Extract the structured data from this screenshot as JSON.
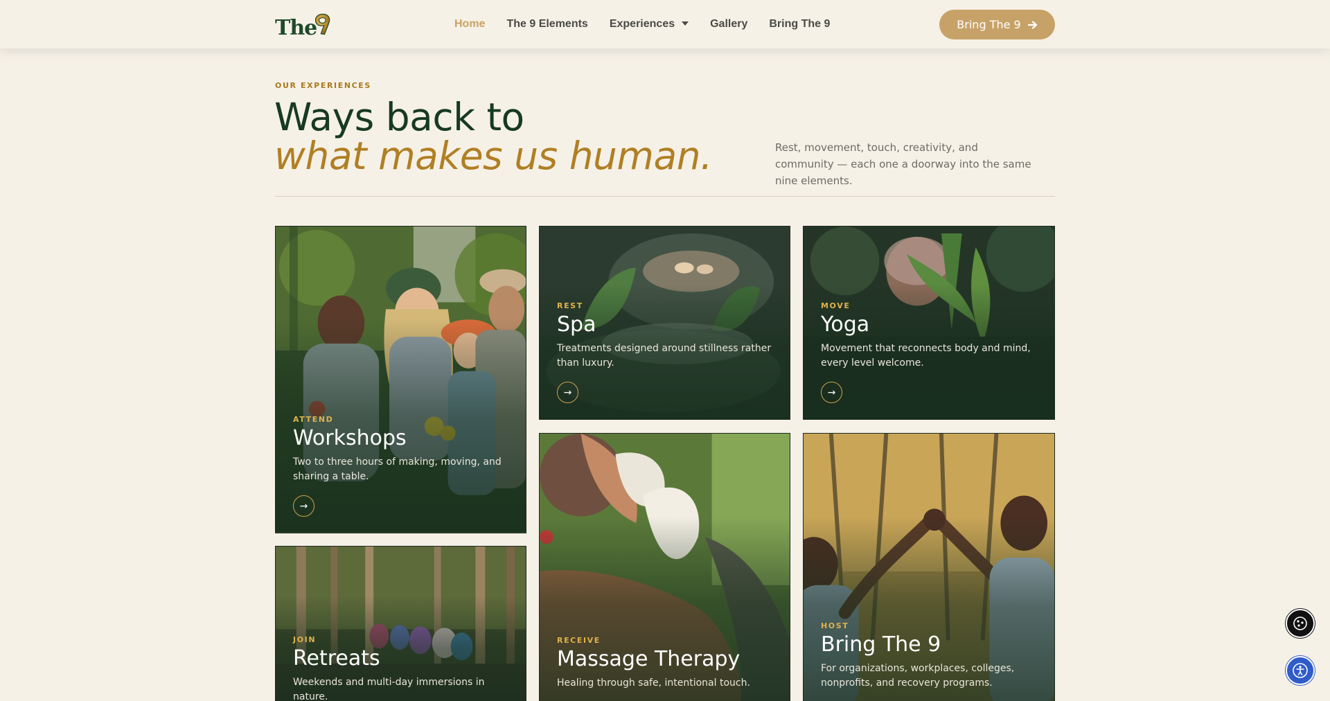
{
  "header": {
    "logo_text": "The",
    "nav": [
      {
        "label": "Home",
        "active": true
      },
      {
        "label": "The 9 Elements"
      },
      {
        "label": "Experiences",
        "dropdown": true
      },
      {
        "label": "Gallery"
      },
      {
        "label": "Bring The 9"
      }
    ],
    "cta_label": "Bring The 9",
    "cta_icon": "arrow-right-icon"
  },
  "intro": {
    "eyebrow": "OUR EXPERIENCES",
    "headline_line1": "Ways back to",
    "headline_line2": "what makes us human.",
    "text": "Rest, movement, touch, creativity, and community — each one a doorway into the same nine elements."
  },
  "cards": {
    "workshops": {
      "tag": "ATTEND",
      "title": "Workshops",
      "desc": "Two to three hours of making, moving, and sharing a table.",
      "arrow": "→"
    },
    "spa": {
      "tag": "REST",
      "title": "Spa",
      "desc": "Treatments designed around stillness rather than luxury.",
      "arrow": "→"
    },
    "yoga": {
      "tag": "MOVE",
      "title": "Yoga",
      "desc": "Movement that reconnects body and mind, every level welcome.",
      "arrow": "→"
    },
    "retreats": {
      "tag": "JOIN",
      "title": "Retreats",
      "desc": "Weekends and multi-day immersions in nature."
    },
    "massage": {
      "tag": "RECEIVE",
      "title": "Massage Therapy",
      "desc": "Healing through safe, intentional touch."
    },
    "host": {
      "tag": "HOST",
      "title": "Bring The 9",
      "desc": "For organizations, workplaces, colleges, nonprofits, and recovery programs."
    }
  },
  "colors": {
    "background": "#f6f1e7",
    "accent_gold": "#c7a268",
    "headline_green": "#173a22",
    "headline_gold": "#b07f24",
    "active_nav": "#c9a263",
    "accessibility_blue": "#2f5cc9"
  },
  "floating": {
    "cookie_icon": "cookie-settings-icon",
    "accessibility_icon": "accessibility-icon"
  }
}
